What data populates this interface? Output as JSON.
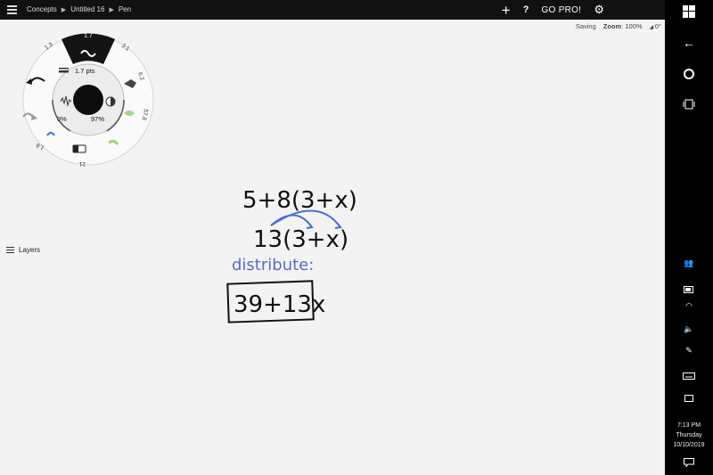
{
  "breadcrumb": [
    "Concepts",
    "Untitled 16",
    "Pen"
  ],
  "toolbar": {
    "go_pro": "GO PRO!",
    "help": "?"
  },
  "status": {
    "saving": "Saving",
    "zoom_label": "Zoom",
    "zoom_value": ": 100%",
    "rotation": "0°"
  },
  "wheel": {
    "size_top": "1.7",
    "size_left": "1.3",
    "size_right": "3.1",
    "slot_6_2": "6.2",
    "slot_57_8": "57.8",
    "slot_21": "21",
    "slot_1_8": "1.8",
    "pts": "1.7 pts",
    "opacity": "0%",
    "smoothing": "97%"
  },
  "layers": {
    "label": "Layers"
  },
  "drawing": {
    "line1": "5+8(3+x)",
    "line2": "13(3+x)",
    "note": "distribute:",
    "result": "39+13x",
    "ink_color": "#111111",
    "note_color": "#5a6cc2"
  },
  "clock": {
    "time": "7:13 PM",
    "day": "Thursday",
    "date": "10/10/2019"
  }
}
